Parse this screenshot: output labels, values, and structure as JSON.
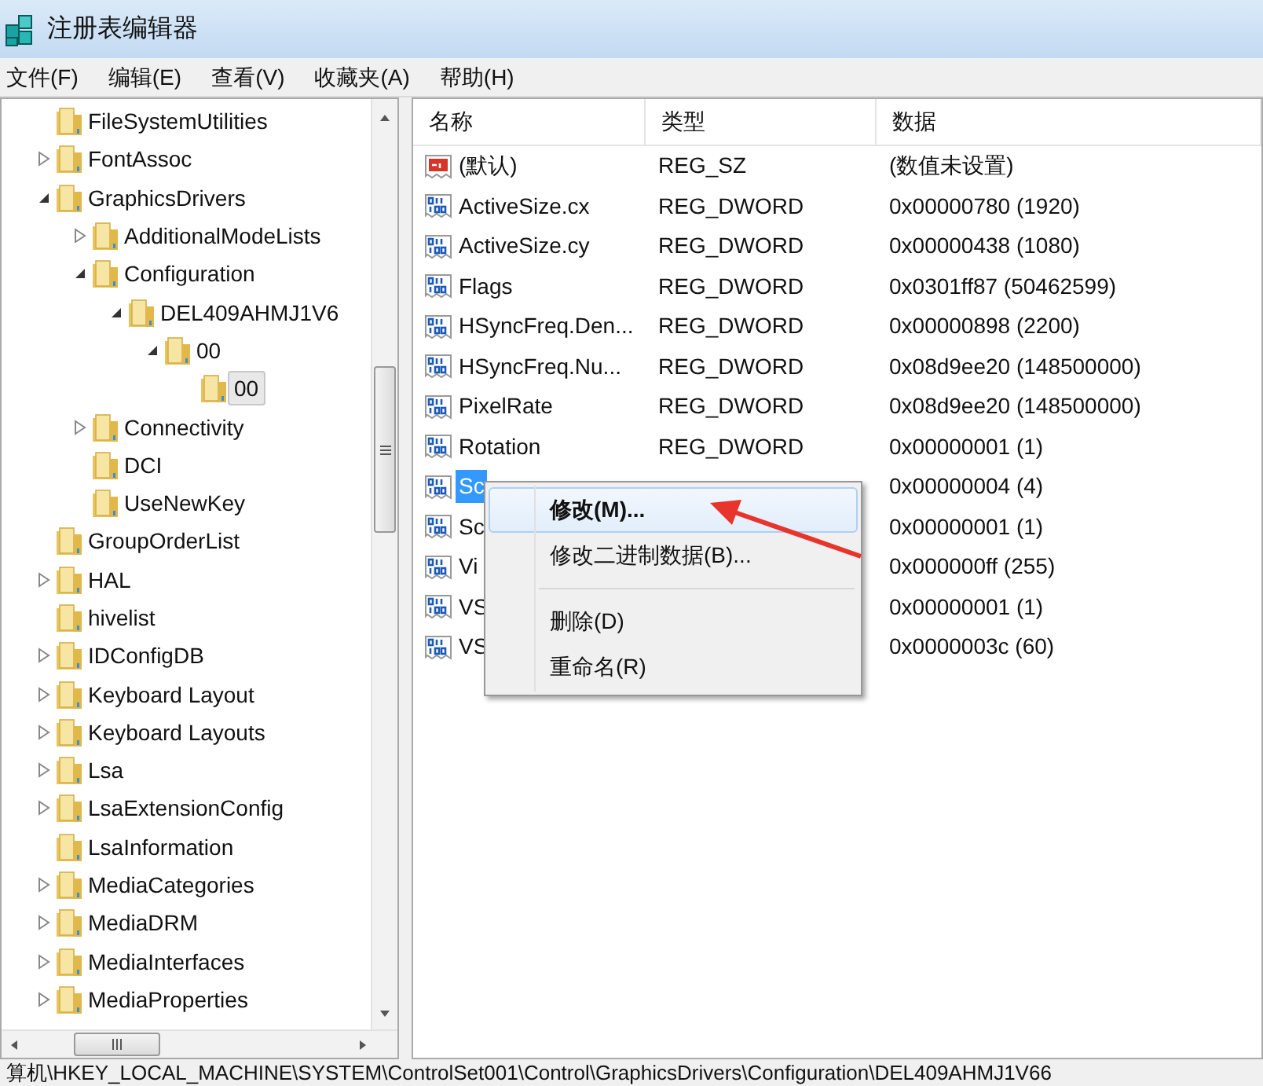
{
  "window": {
    "title": "注册表编辑器"
  },
  "menu_bar": [
    "文件(F)",
    "编辑(E)",
    "查看(V)",
    "收藏夹(A)",
    "帮助(H)"
  ],
  "tree": [
    {
      "label": "FileSystemUtilities",
      "selected": false
    },
    {
      "label": "FontAssoc",
      "expanded": false,
      "selected": false
    },
    {
      "label": "GraphicsDrivers",
      "expanded": true,
      "selected": false,
      "children": [
        {
          "label": "AdditionalModeLists",
          "expanded": false,
          "selected": false
        },
        {
          "label": "Configuration",
          "expanded": true,
          "selected": false,
          "children": [
            {
              "label": "DEL409AHMJ1V6",
              "expanded": true,
              "selected": false,
              "children": [
                {
                  "label": "00",
                  "expanded": true,
                  "selected": false,
                  "children": [
                    {
                      "label": "00",
                      "selected": true
                    }
                  ]
                }
              ]
            }
          ]
        },
        {
          "label": "Connectivity",
          "expanded": false,
          "selected": false
        },
        {
          "label": "DCI",
          "selected": false
        },
        {
          "label": "UseNewKey",
          "selected": false
        }
      ]
    },
    {
      "label": "GroupOrderList",
      "selected": false
    },
    {
      "label": "HAL",
      "expanded": false,
      "selected": false
    },
    {
      "label": "hivelist",
      "selected": false
    },
    {
      "label": "IDConfigDB",
      "expanded": false,
      "selected": false
    },
    {
      "label": "Keyboard Layout",
      "expanded": false,
      "selected": false
    },
    {
      "label": "Keyboard Layouts",
      "expanded": false,
      "selected": false
    },
    {
      "label": "Lsa",
      "expanded": false,
      "selected": false
    },
    {
      "label": "LsaExtensionConfig",
      "expanded": false,
      "selected": false
    },
    {
      "label": "LsaInformation",
      "selected": false
    },
    {
      "label": "MediaCategories",
      "expanded": false,
      "selected": false
    },
    {
      "label": "MediaDRM",
      "expanded": false,
      "selected": false
    },
    {
      "label": "MediaInterfaces",
      "expanded": false,
      "selected": false
    },
    {
      "label": "MediaProperties",
      "expanded": false,
      "selected": false
    }
  ],
  "values": {
    "columns": [
      "名称",
      "类型",
      "数据"
    ],
    "rows": [
      {
        "kind": "string",
        "name": "(默认)",
        "type": "REG_SZ",
        "data": "(数值未设置)",
        "selected": false
      },
      {
        "kind": "dword",
        "name": "ActiveSize.cx",
        "type": "REG_DWORD",
        "data": "0x00000780 (1920)",
        "selected": false
      },
      {
        "kind": "dword",
        "name": "ActiveSize.cy",
        "type": "REG_DWORD",
        "data": "0x00000438 (1080)",
        "selected": false
      },
      {
        "kind": "dword",
        "name": "Flags",
        "type": "REG_DWORD",
        "data": "0x0301ff87 (50462599)",
        "selected": false
      },
      {
        "kind": "dword",
        "name": "HSyncFreq.Den...",
        "type": "REG_DWORD",
        "data": "0x00000898 (2200)",
        "selected": false
      },
      {
        "kind": "dword",
        "name": "HSyncFreq.Nu...",
        "type": "REG_DWORD",
        "data": "0x08d9ee20 (148500000)",
        "selected": false
      },
      {
        "kind": "dword",
        "name": "PixelRate",
        "type": "REG_DWORD",
        "data": "0x08d9ee20 (148500000)",
        "selected": false
      },
      {
        "kind": "dword",
        "name": "Rotation",
        "type": "REG_DWORD",
        "data": "0x00000001 (1)",
        "selected": false
      },
      {
        "kind": "dword",
        "name": "Sc",
        "data": "0x00000004 (4)",
        "selected": true
      },
      {
        "kind": "dword",
        "name": "Sc",
        "data": "0x00000001 (1)",
        "selected": false
      },
      {
        "kind": "dword",
        "name": "Vi",
        "data": "0x000000ff (255)",
        "selected": false
      },
      {
        "kind": "dword",
        "name": "VS",
        "data": "0x00000001 (1)",
        "selected": false
      },
      {
        "kind": "dword",
        "name": "VS",
        "data": "0x0000003c (60)",
        "selected": false
      }
    ]
  },
  "context_menu": [
    {
      "kind": "item",
      "label": "修改(M)...",
      "default": true,
      "selected": true
    },
    {
      "kind": "item",
      "label": "修改二进制数据(B)...",
      "default": false,
      "selected": false
    },
    {
      "kind": "separator"
    },
    {
      "kind": "item",
      "label": "删除(D)",
      "default": false,
      "selected": false
    },
    {
      "kind": "item",
      "label": "重命名(R)",
      "default": false,
      "selected": false
    }
  ],
  "status_bar": "算机\\HKEY_LOCAL_MACHINE\\SYSTEM\\ControlSet001\\Control\\GraphicsDrivers\\Configuration\\DEL409AHMJ1V66"
}
